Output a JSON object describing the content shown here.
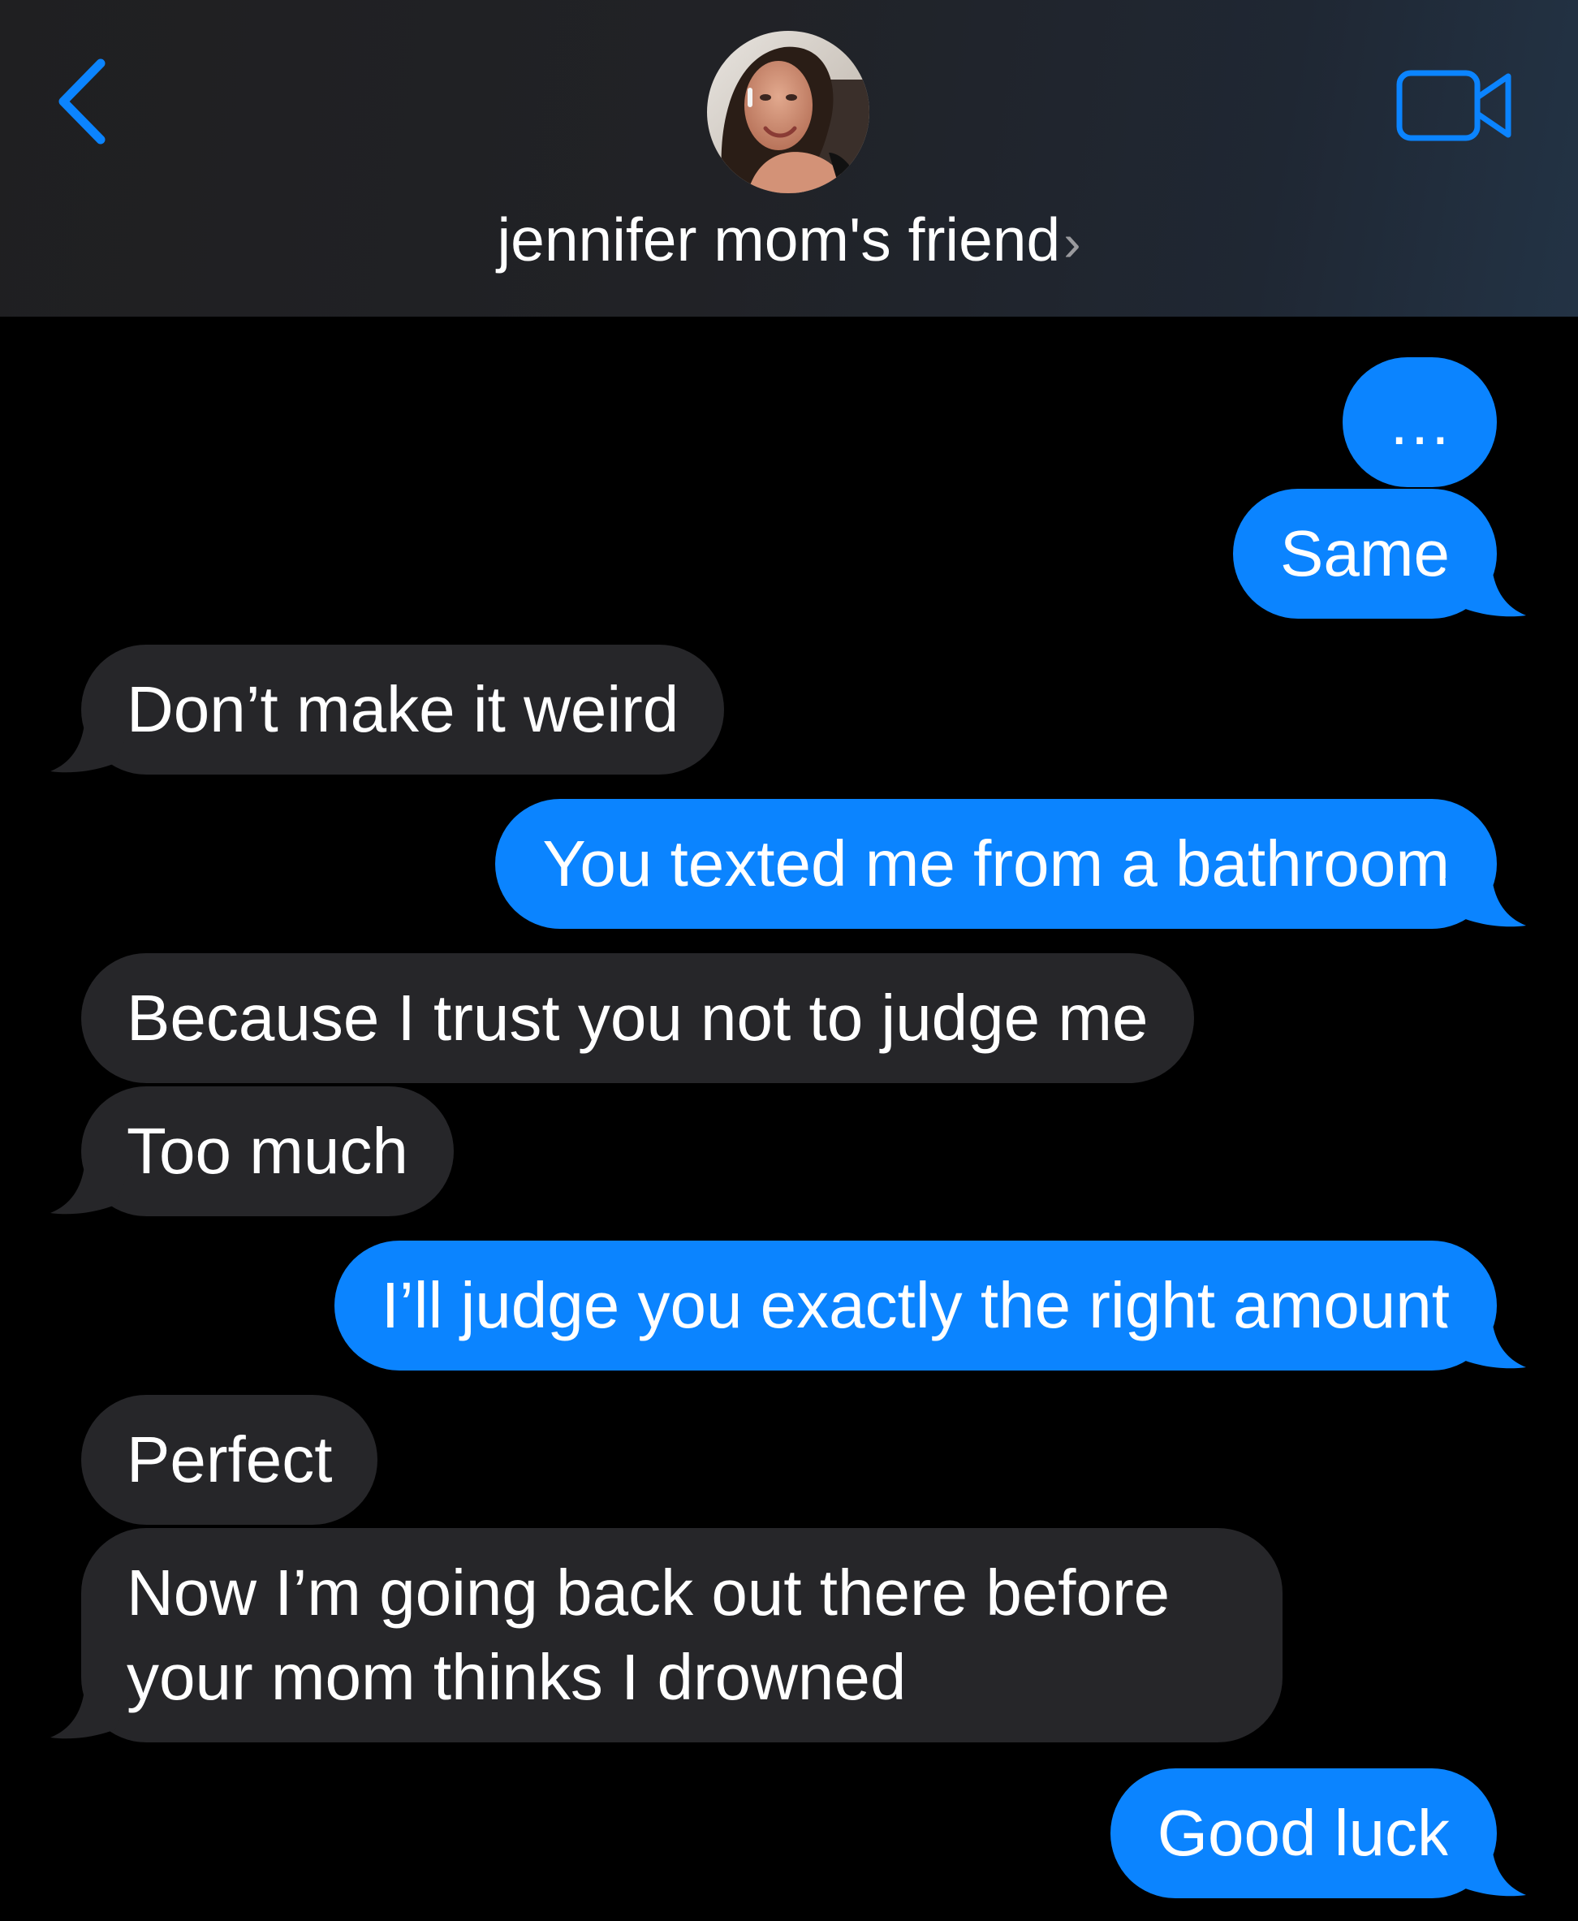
{
  "header": {
    "contact_name": "jennifer mom's friend",
    "chevron": "›",
    "back_icon": "chevron-left-icon",
    "video_icon": "video-camera-icon",
    "accent_color": "#0b84ff"
  },
  "colors": {
    "sent_bubble": "#0b84ff",
    "received_bubble": "#262629",
    "background": "#000000"
  },
  "messages": [
    {
      "direction": "sent",
      "text": "…"
    },
    {
      "direction": "sent",
      "text": "Same"
    },
    {
      "direction": "received",
      "text": "Don’t make it weird"
    },
    {
      "direction": "sent",
      "text": "You texted me from a bathroom"
    },
    {
      "direction": "received",
      "text": "Because I trust you not to judge me"
    },
    {
      "direction": "received",
      "text": "Too much"
    },
    {
      "direction": "sent",
      "text": "I’ll judge you exactly the right amount"
    },
    {
      "direction": "received",
      "text": "Perfect"
    },
    {
      "direction": "received",
      "text": "Now I’m going back out there before your mom thinks I drowned"
    },
    {
      "direction": "sent",
      "text": "Good luck"
    }
  ]
}
